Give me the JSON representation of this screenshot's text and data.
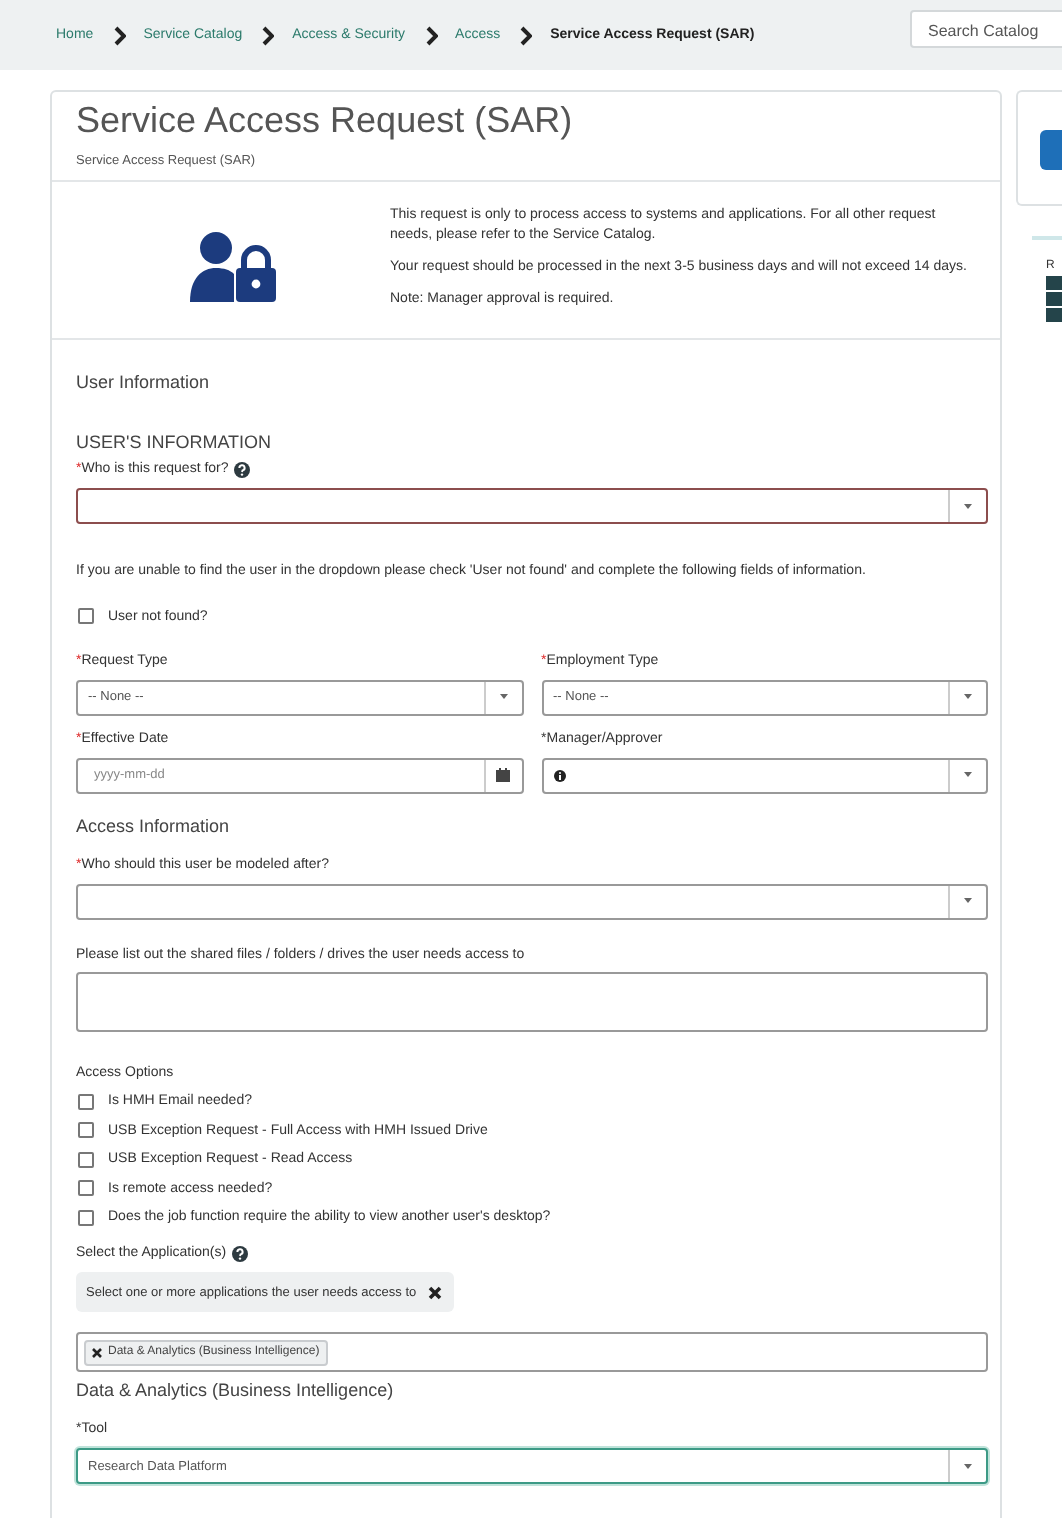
{
  "breadcrumb": {
    "items": [
      {
        "label": "Home",
        "current": false
      },
      {
        "label": "Service Catalog",
        "current": false
      },
      {
        "label": "Access & Security",
        "current": false
      },
      {
        "label": "Access",
        "current": false
      },
      {
        "label": "Service Access Request (SAR)",
        "current": true
      }
    ],
    "search": {
      "placeholder": "Search Catalog"
    }
  },
  "card": {
    "title": "Service Access Request (SAR)",
    "subtitle": "Service Access Request (SAR)",
    "info": [
      "This request is only to process access to systems and applications. For all other request needs, please refer to the Service Catalog.",
      "Your request should be processed in the next 3-5 business days and will not exceed 14 days.",
      "Note: Manager approval is required."
    ]
  },
  "required_mark": "*",
  "form": {
    "items": [
      {
        "kind": "section",
        "text": "User Information"
      },
      {
        "kind": "heading",
        "text": "USER'S INFORMATION"
      },
      {
        "kind": "select",
        "label": "Who is this request for?",
        "required": true,
        "mark_filled": false,
        "help": true,
        "invalid": true,
        "focused": false
      },
      {
        "kind": "note",
        "text": "If you are unable to find the user in the dropdown please check 'User not found' and complete the following fields of information."
      },
      {
        "kind": "checkbox",
        "label": "User not found?",
        "checked": false
      },
      {
        "kind": "row",
        "fields": [
          {
            "kind": "select",
            "label": "Request Type",
            "required": true,
            "mark_filled": false,
            "value": "-- None --",
            "invalid": false,
            "focused": false
          },
          {
            "kind": "select",
            "label": "Employment Type",
            "required": true,
            "mark_filled": false,
            "value": "-- None --",
            "invalid": false,
            "focused": false
          }
        ]
      },
      {
        "kind": "row",
        "fields": [
          {
            "kind": "date",
            "label": "Effective Date",
            "required": true,
            "mark_filled": false,
            "placeholder": "yyyy-mm-dd"
          },
          {
            "kind": "reference",
            "label": "Manager/Approver",
            "required": true,
            "mark_filled": true
          }
        ]
      },
      {
        "kind": "section",
        "text": "Access Information"
      },
      {
        "kind": "select",
        "label": "Who should this user be modeled after?",
        "required": true,
        "mark_filled": false,
        "invalid": false,
        "focused": false
      },
      {
        "kind": "textarea",
        "label": "Please list out the shared files / folders / drives the user needs access to"
      },
      {
        "kind": "group_label",
        "text": "Access Options"
      },
      {
        "kind": "checkbox",
        "label": "Is HMH Email needed?",
        "checked": false
      },
      {
        "kind": "checkbox",
        "label": "USB Exception Request - Full Access with HMH Issued Drive",
        "checked": false
      },
      {
        "kind": "checkbox",
        "label": "USB Exception Request - Read Access",
        "checked": false
      },
      {
        "kind": "checkbox",
        "label": "Is remote access needed?",
        "checked": false
      },
      {
        "kind": "checkbox",
        "label": "Does the job function require the ability to view another user's desktop?",
        "checked": false
      },
      {
        "kind": "multi",
        "label": "Select the Application(s)",
        "help": true,
        "hint": "Select one or more applications the user needs access to",
        "tags": [
          "Data & Analytics (Business Intelligence)"
        ]
      },
      {
        "kind": "section",
        "text": "Data & Analytics (Business Intelligence)"
      },
      {
        "kind": "select",
        "label": "Tool",
        "required": true,
        "mark_filled": true,
        "value": "Research Data Platform",
        "invalid": false,
        "focused": true
      }
    ]
  },
  "side_panel": {
    "label": "R"
  }
}
